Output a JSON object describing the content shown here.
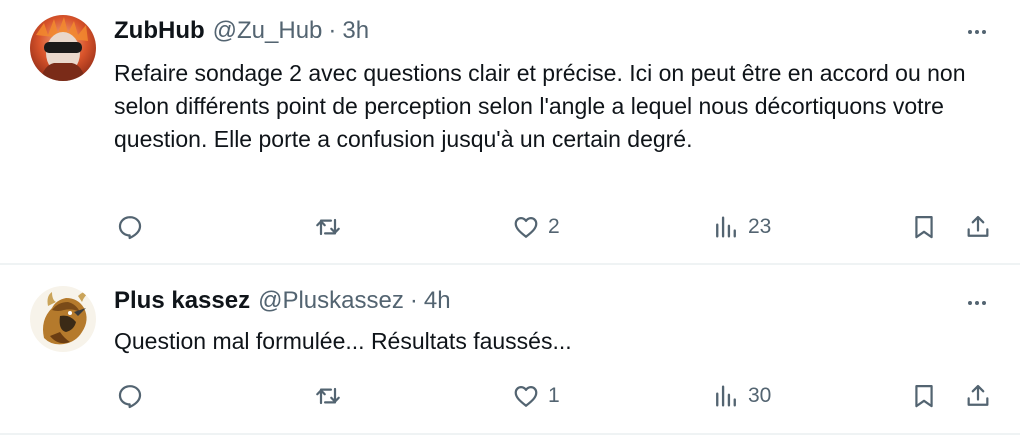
{
  "tweets": [
    {
      "display_name": "ZubHub",
      "handle": "@Zu_Hub",
      "separator": "·",
      "time": "3h",
      "text": "Refaire sondage 2 avec questions clair et précise.  Ici on peut être en accord ou non selon différents point de perception selon l'angle a lequel nous décortiquons votre question.  Elle porte a confusion jusqu'à un certain degré.",
      "actions": {
        "reply_count": "",
        "retweet_count": "",
        "like_count": "2",
        "views_count": "23"
      },
      "avatar_icon": "masked-person-avatar"
    },
    {
      "display_name": "Plus kassez",
      "handle": "@Pluskassez",
      "separator": "·",
      "time": "4h",
      "text": "Question mal formulée... Résultats faussés...",
      "actions": {
        "reply_count": "",
        "retweet_count": "",
        "like_count": "1",
        "views_count": "30"
      },
      "avatar_icon": "phoenix-bird-avatar"
    }
  ],
  "icons": {
    "reply": "reply-icon",
    "retweet": "retweet-icon",
    "like": "heart-icon",
    "views": "views-icon",
    "bookmark": "bookmark-icon",
    "share": "share-icon",
    "more": "more-icon"
  },
  "colors": {
    "text_primary": "#0f1419",
    "text_secondary": "#536471",
    "divider": "#eff3f4"
  }
}
